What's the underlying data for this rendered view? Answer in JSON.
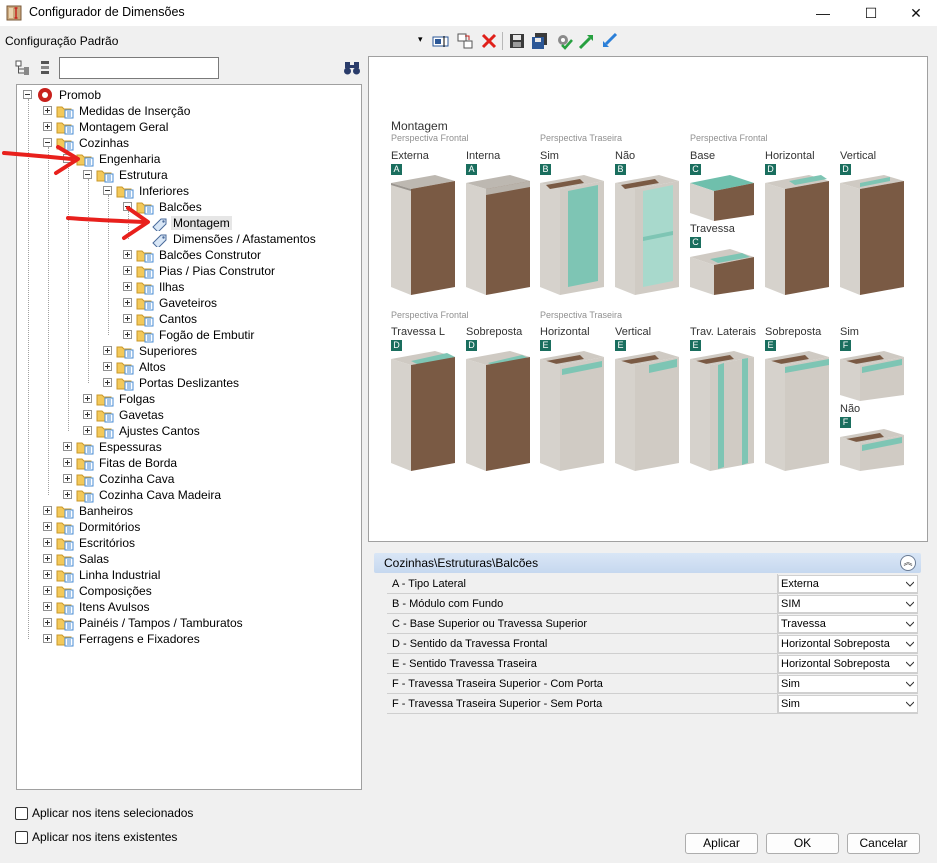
{
  "window": {
    "title": "Configurador de Dimensões",
    "minimize": "—",
    "maximize": "☐",
    "close": "✕"
  },
  "toolbar": {
    "config_label": "Configuração Padrão",
    "dropdown_arrow": "▾"
  },
  "tree": {
    "root": "Promob",
    "items": [
      {
        "label": "Medidas de Inserção"
      },
      {
        "label": "Montagem Geral"
      },
      {
        "label": "Cozinhas"
      },
      {
        "label": "Engenharia"
      },
      {
        "label": "Estrutura"
      },
      {
        "label": "Inferiores"
      },
      {
        "label": "Balcões"
      },
      {
        "label": "Montagem"
      },
      {
        "label": "Dimensões / Afastamentos"
      },
      {
        "label": "Balcões Construtor"
      },
      {
        "label": "Pias / Pias Construtor"
      },
      {
        "label": "Ilhas"
      },
      {
        "label": "Gaveteiros"
      },
      {
        "label": "Cantos"
      },
      {
        "label": "Fogão de Embutir"
      },
      {
        "label": "Superiores"
      },
      {
        "label": "Altos"
      },
      {
        "label": "Portas Deslizantes"
      },
      {
        "label": "Folgas"
      },
      {
        "label": "Gavetas"
      },
      {
        "label": "Ajustes Cantos"
      },
      {
        "label": "Espessuras"
      },
      {
        "label": "Fitas de Borda"
      },
      {
        "label": "Cozinha Cava"
      },
      {
        "label": "Cozinha Cava Madeira"
      },
      {
        "label": "Banheiros"
      },
      {
        "label": "Dormitórios"
      },
      {
        "label": "Escritórios"
      },
      {
        "label": "Salas"
      },
      {
        "label": "Linha Industrial"
      },
      {
        "label": "Composições"
      },
      {
        "label": "Itens Avulsos"
      },
      {
        "label": "Painéis / Tampos / Tamburatos"
      },
      {
        "label": "Ferragens e Fixadores"
      }
    ]
  },
  "checkboxes": {
    "selected_items": "Aplicar nos itens selecionados",
    "existing_items": "Aplicar nos itens existentes"
  },
  "preview": {
    "title": "Montagem",
    "subs": [
      "Perspectiva Frontal",
      "Perspectiva Traseira",
      "Perspectiva Frontal",
      "Perspectiva Frontal",
      "Perspectiva Traseira"
    ],
    "names": [
      "Externa",
      "Interna",
      "Sim",
      "Não",
      "Base",
      "Horizontal",
      "Vertical",
      "Travessa",
      "Travessa L",
      "Sobreposta",
      "Horizontal",
      "Vertical",
      "Trav. Laterais",
      "Sobreposta",
      "Sim",
      "Não"
    ],
    "badges": [
      "A",
      "A",
      "B",
      "B",
      "C",
      "D",
      "D",
      "C",
      "D",
      "D",
      "E",
      "E",
      "E",
      "E",
      "F",
      "F"
    ]
  },
  "properties": {
    "header": "Cozinhas\\Estruturas\\Balcões",
    "rows": [
      {
        "name": "A - Tipo Lateral",
        "value": "Externa"
      },
      {
        "name": "B - Módulo com Fundo",
        "value": "SIM"
      },
      {
        "name": "C - Base Superior ou Travessa Superior",
        "value": "Travessa"
      },
      {
        "name": "D - Sentido da Travessa Frontal",
        "value": "Horizontal Sobreposta"
      },
      {
        "name": "E - Sentido Travessa Traseira",
        "value": "Horizontal Sobreposta"
      },
      {
        "name": "F - Travessa Traseira Superior - Com Porta",
        "value": "Sim"
      },
      {
        "name": "F - Travessa Traseira Superior - Sem Porta",
        "value": "Sim"
      }
    ]
  },
  "buttons": {
    "apply": "Aplicar",
    "ok": "OK",
    "cancel": "Cancelar"
  },
  "colors": {
    "accent_teal": "#1a6e5e",
    "glass": "#7ec5b4",
    "wood": "#7a5a44",
    "panel_gray": "#d6d2cc",
    "arrow_red": "#e8201c"
  }
}
